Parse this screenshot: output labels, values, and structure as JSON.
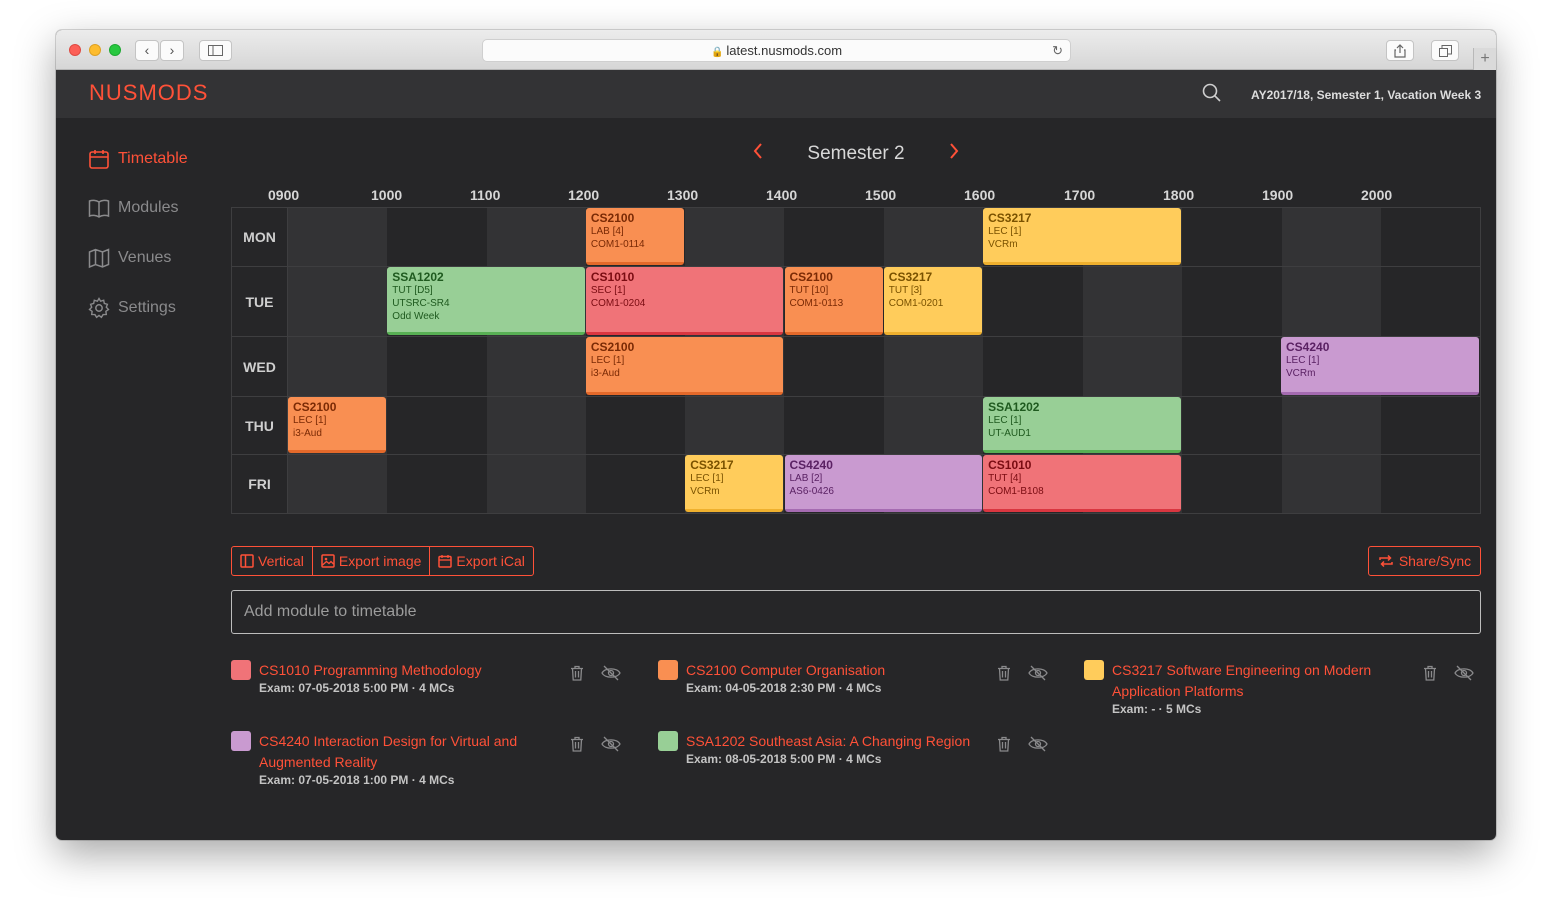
{
  "browser": {
    "url": "latest.nusmods.com"
  },
  "header": {
    "logo": "NUSMODS",
    "semester_info": "AY2017/18, Semester 1, Vacation Week 3"
  },
  "sidebar": {
    "items": [
      {
        "label": "Timetable",
        "icon": "calendar-icon",
        "active": true
      },
      {
        "label": "Modules",
        "icon": "book-icon",
        "active": false
      },
      {
        "label": "Venues",
        "icon": "map-icon",
        "active": false
      },
      {
        "label": "Settings",
        "icon": "gear-icon",
        "active": false
      }
    ]
  },
  "timetable": {
    "semester_title": "Semester 2",
    "hours": [
      "0900",
      "1000",
      "1100",
      "1200",
      "1300",
      "1400",
      "1500",
      "1600",
      "1700",
      "1800",
      "1900",
      "2000"
    ],
    "days": [
      "MON",
      "TUE",
      "WED",
      "THU",
      "FRI"
    ],
    "lessons": [
      {
        "day": "MON",
        "start": 1200,
        "end": 1300,
        "code": "CS2100",
        "type": "LAB [4]",
        "venue": "COM1-0114",
        "color": "orange"
      },
      {
        "day": "MON",
        "start": 1600,
        "end": 1800,
        "code": "CS3217",
        "type": "LEC [1]",
        "venue": "VCRm",
        "color": "yellow"
      },
      {
        "day": "TUE",
        "start": 1000,
        "end": 1200,
        "code": "SSA1202",
        "type": "TUT [D5]",
        "venue": "UTSRC-SR4",
        "extra": "Odd Week",
        "color": "green"
      },
      {
        "day": "TUE",
        "start": 1200,
        "end": 1400,
        "code": "CS1010",
        "type": "SEC [1]",
        "venue": "COM1-0204",
        "color": "red"
      },
      {
        "day": "TUE",
        "start": 1400,
        "end": 1500,
        "code": "CS2100",
        "type": "TUT [10]",
        "venue": "COM1-0113",
        "color": "orange"
      },
      {
        "day": "TUE",
        "start": 1500,
        "end": 1600,
        "code": "CS3217",
        "type": "TUT [3]",
        "venue": "COM1-0201",
        "color": "yellow"
      },
      {
        "day": "WED",
        "start": 1200,
        "end": 1400,
        "code": "CS2100",
        "type": "LEC [1]",
        "venue": "i3-Aud",
        "color": "orange"
      },
      {
        "day": "WED",
        "start": 1900,
        "end": 2100,
        "code": "CS4240",
        "type": "LEC [1]",
        "venue": "VCRm",
        "color": "purple"
      },
      {
        "day": "THU",
        "start": 900,
        "end": 1000,
        "code": "CS2100",
        "type": "LEC [1]",
        "venue": "i3-Aud",
        "color": "orange"
      },
      {
        "day": "THU",
        "start": 1600,
        "end": 1800,
        "code": "SSA1202",
        "type": "LEC [1]",
        "venue": "UT-AUD1",
        "color": "green"
      },
      {
        "day": "FRI",
        "start": 1300,
        "end": 1400,
        "code": "CS3217",
        "type": "LEC [1]",
        "venue": "VCRm",
        "color": "yellow"
      },
      {
        "day": "FRI",
        "start": 1400,
        "end": 1600,
        "code": "CS4240",
        "type": "LAB [2]",
        "venue": "AS6-0426",
        "color": "purple"
      },
      {
        "day": "FRI",
        "start": 1600,
        "end": 1800,
        "code": "CS1010",
        "type": "TUT [4]",
        "venue": "COM1-B108",
        "color": "red"
      }
    ]
  },
  "colors": {
    "accent": "#ff5138",
    "orange": {
      "bg": "#f98f52",
      "text": "#7a2a05",
      "border": "#e4692a"
    },
    "yellow": {
      "bg": "#ffcc5b",
      "text": "#7a5200",
      "border": "#efb02e"
    },
    "green": {
      "bg": "#98cf96",
      "text": "#1f5a1f",
      "border": "#58b054"
    },
    "red": {
      "bg": "#f07378",
      "text": "#7a0c12",
      "border": "#d93640"
    },
    "purple": {
      "bg": "#c99ad0",
      "text": "#5a2163",
      "border": "#a56bb1"
    }
  },
  "toolbar": {
    "vertical": "Vertical",
    "export_image": "Export image",
    "export_ical": "Export iCal",
    "share": "Share/Sync"
  },
  "add_module": {
    "placeholder": "Add module to timetable"
  },
  "modules": [
    {
      "title": "CS1010 Programming Methodology",
      "exam": "Exam: 07-05-2018 5:00 PM · 4 MCs",
      "color": "red"
    },
    {
      "title": "CS2100 Computer Organisation",
      "exam": "Exam: 04-05-2018 2:30 PM · 4 MCs",
      "color": "orange"
    },
    {
      "title": "CS3217 Software Engineering on Modern Application Platforms",
      "exam": "Exam: - · 5 MCs",
      "color": "yellow"
    },
    {
      "title": "CS4240 Interaction Design for Virtual and Augmented Reality",
      "exam": "Exam: 07-05-2018 1:00 PM · 4 MCs",
      "color": "purple"
    },
    {
      "title": "SSA1202 Southeast Asia: A Changing Region",
      "exam": "Exam: 08-05-2018 5:00 PM · 4 MCs",
      "color": "green"
    }
  ]
}
